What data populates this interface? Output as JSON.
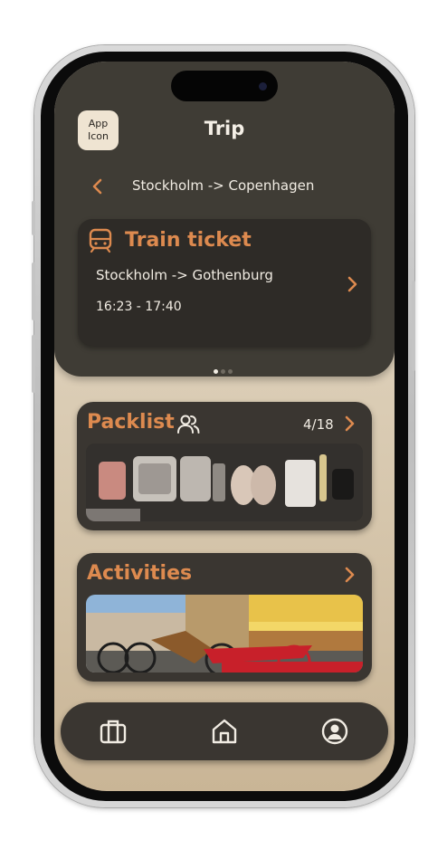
{
  "header": {
    "app_icon_label": "App\nIcon",
    "title": "Trip"
  },
  "trip": {
    "route": "Stockholm -> Copenhagen"
  },
  "ticket": {
    "title": "Train ticket",
    "route": "Stockholm -> Gothenburg",
    "time": "16:23 - 17:40"
  },
  "carousel": {
    "pages": 3,
    "active_index": 0
  },
  "packlist": {
    "title": "Packlist",
    "count": "4/18"
  },
  "activities": {
    "title": "Activities"
  },
  "nav": {
    "items": [
      "luggage-icon",
      "home-icon",
      "profile-icon"
    ]
  },
  "colors": {
    "accent": "#dd8a4f",
    "panel": "#3f3c35",
    "card": "#3a3631",
    "text": "#f1ece3"
  }
}
